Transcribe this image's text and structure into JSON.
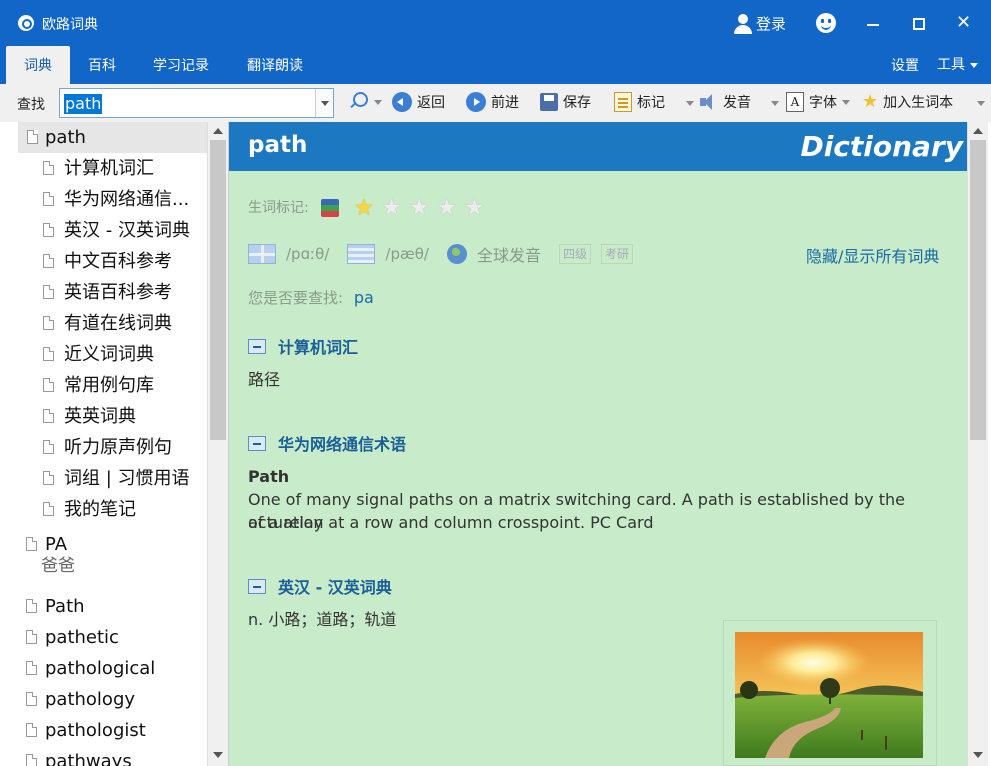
{
  "window": {
    "title": "欧路词典",
    "login_label": "登录",
    "logo_icon": "eudic-logo-icon",
    "colors": {
      "titlebar": "#1166c8",
      "content_bg": "#c8ebc9",
      "header_bg": "#1c78c0"
    }
  },
  "tabs": [
    {
      "label": "词典",
      "active": true
    },
    {
      "label": "百科",
      "active": false
    },
    {
      "label": "学习记录",
      "active": false
    },
    {
      "label": "翻译朗读",
      "active": false
    }
  ],
  "tab_right": {
    "settings": "设置",
    "tools": "工具"
  },
  "toolbar": {
    "find_label": "查找",
    "search_value": "path",
    "back": "返回",
    "forward": "前进",
    "save": "保存",
    "mark": "标记",
    "pronounce": "发音",
    "font": "字体",
    "add_wordbook": "加入生词本"
  },
  "word_list": {
    "selected": "path",
    "dict_sources": [
      "计算机词汇",
      "华为网络通信...",
      "英汉 - 汉英词典",
      "中文百科参考",
      "英语百科参考",
      "有道在线词典",
      "近义词词典",
      "常用例句库",
      "英英词典",
      "听力原声例句",
      "词组 | 习惯用语",
      "我的笔记"
    ],
    "pa": {
      "word": "PA",
      "gloss": "爸爸"
    },
    "more_words": [
      "Path",
      "pathetic",
      "pathological",
      "pathology",
      "pathologist",
      "pathways"
    ]
  },
  "entry": {
    "word": "path",
    "brand": "Dictionary",
    "rating_label": "生词标记:",
    "rating": 1,
    "rating_max": 5,
    "uk_phonetic": "/pɑːθ/",
    "us_phonetic": "/pæθ/",
    "global_pron": "全球发音",
    "levels": [
      "四级",
      "考研"
    ],
    "toggle_dicts": "隐藏/显示所有词典",
    "did_you_mean_label": "您是否要查找:",
    "did_you_mean": "pa",
    "sections": [
      {
        "title": "计算机词汇",
        "body": "路径"
      },
      {
        "title": "华为网络通信术语",
        "term": "Path",
        "body_line1": "One of many signal paths on a matrix switching card. A path is established by the actuation",
        "body_line2": "of a relay at a row and column crosspoint. PC Card"
      },
      {
        "title": "英汉 - 汉英词典",
        "body": "n. 小路；道路；轨道"
      }
    ],
    "photo_icon": "path-landscape-photo"
  }
}
